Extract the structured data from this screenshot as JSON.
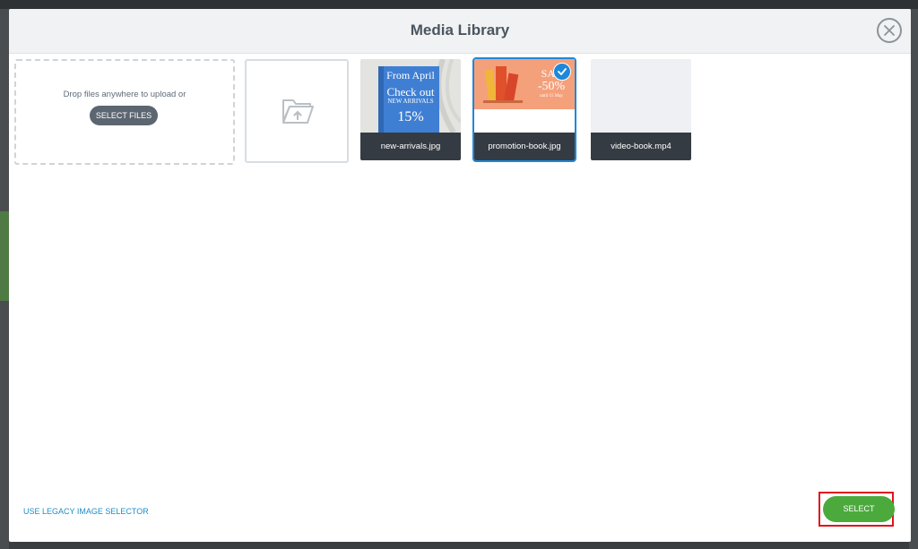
{
  "modal": {
    "title": "Media Library"
  },
  "upload": {
    "text": "Drop files anywhere to upload or",
    "button_label": "SELECT FILES"
  },
  "media": [
    {
      "name": "new-arrivals.jpg",
      "selected": false,
      "thumb_lines": [
        "From April",
        "Check out",
        "NEW ARRIVALS",
        "15%"
      ]
    },
    {
      "name": "promotion-book.jpg",
      "selected": true,
      "thumb_lines": [
        "SAL",
        "-50%",
        "until 15 May"
      ]
    },
    {
      "name": "video-book.mp4",
      "selected": false
    }
  ],
  "footer": {
    "legacy_link": "USE LEGACY IMAGE SELECTOR",
    "select_label": "SELECT"
  },
  "colors": {
    "primary_action": "#4caa3d",
    "selection": "#1e88d8",
    "highlight": "#e0141e"
  },
  "icons": {
    "close": "close-icon",
    "folder": "folder-upload-icon",
    "check": "check-icon"
  }
}
